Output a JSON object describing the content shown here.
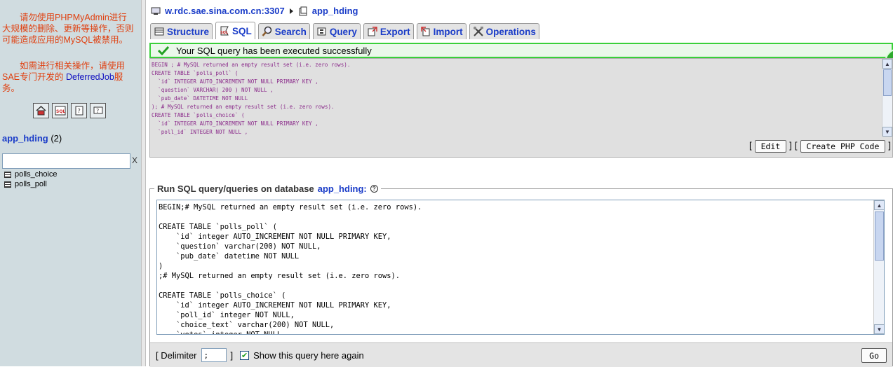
{
  "nav": {
    "notice1_part1": "请勿使用PHPMyAdmin进行大规模的删除、更新等操作，否则可能造成应用的MySQL被禁用。",
    "notice2_part1": "如需进行相关操作，请使用SAE专门开发的 ",
    "notice2_link": "DeferredJob",
    "notice2_part2": "服务。",
    "icons": [
      "home-icon",
      "sql-icon",
      "query-window-icon",
      "docs-icon"
    ],
    "db_name": "app_hding",
    "db_count": "(2)",
    "filter_clear": "X",
    "tables": [
      "polls_choice",
      "polls_poll"
    ]
  },
  "breadcrumb": {
    "server": "w.rdc.sae.sina.com.cn:3307",
    "database": "app_hding"
  },
  "tabs": [
    {
      "label": "Structure",
      "icon": "structure-icon"
    },
    {
      "label": "SQL",
      "icon": "sql-icon"
    },
    {
      "label": "Search",
      "icon": "search-icon"
    },
    {
      "label": "Query",
      "icon": "query-icon"
    },
    {
      "label": "Export",
      "icon": "export-icon"
    },
    {
      "label": "Import",
      "icon": "import-icon"
    },
    {
      "label": "Operations",
      "icon": "operations-icon"
    }
  ],
  "active_tab": "SQL",
  "success": {
    "message": "Your SQL query has been executed successfully"
  },
  "result_sql": "BEGIN ; # MySQL returned an empty result set (i.e. zero rows).\nCREATE TABLE `polls_poll` (\n  `id` INTEGER AUTO_INCREMENT NOT NULL PRIMARY KEY ,\n  `question` VARCHAR( 200 ) NOT NULL ,\n  `pub_date` DATETIME NOT NULL\n); # MySQL returned an empty result set (i.e. zero rows).\nCREATE TABLE `polls_choice` (\n  `id` INTEGER AUTO_INCREMENT NOT NULL PRIMARY KEY ,\n  `poll_id` INTEGER NOT NULL ,",
  "result_actions": {
    "bracket_open": "[",
    "bracket_close": "]",
    "edit_label": "Edit",
    "php_label": "Create PHP Code"
  },
  "query_form": {
    "legend_prefix": "Run SQL query/queries on database",
    "legend_db": "app_hding:",
    "help_icon": "help-icon",
    "query_text": "BEGIN;# MySQL returned an empty result set (i.e. zero rows).\n\nCREATE TABLE `polls_poll` (\n    `id` integer AUTO_INCREMENT NOT NULL PRIMARY KEY,\n    `question` varchar(200) NOT NULL,\n    `pub_date` datetime NOT NULL\n)\n;# MySQL returned an empty result set (i.e. zero rows).\n\nCREATE TABLE `polls_choice` (\n    `id` integer AUTO_INCREMENT NOT NULL PRIMARY KEY,\n    `poll_id` integer NOT NULL,\n    `choice_text` varchar(200) NOT NULL,\n    `votes` integer NOT NULL",
    "delimiter_label_open": "[ Delimiter",
    "delimiter_value": ";",
    "delimiter_label_close": "]",
    "show_again_checked": true,
    "show_again_label": "Show this query here again",
    "go_label": "Go"
  }
}
